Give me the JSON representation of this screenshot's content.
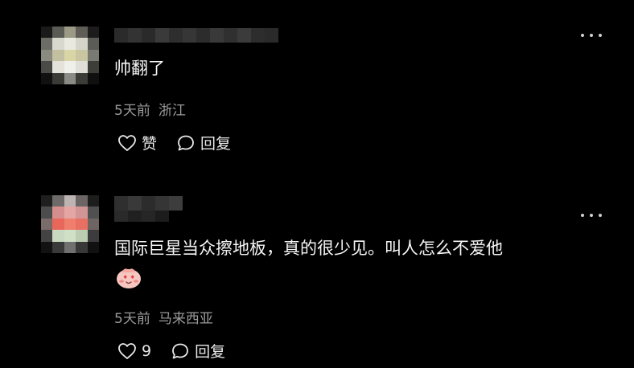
{
  "comments": [
    {
      "text": "帅翻了",
      "time": "5天前",
      "location": "浙江",
      "like_label": "赞",
      "reply_label": "回复"
    },
    {
      "text": "国际巨星当众擦地板，真的很少见。叫人怎么不爱他",
      "time": "5天前",
      "location": "马来西亚",
      "like_label": "9",
      "reply_label": "回复"
    }
  ],
  "colors": {
    "background": "#000000",
    "text": "#f5f5f5",
    "meta": "#9a9a9a"
  },
  "icons": [
    "more-icon",
    "heart-icon",
    "comment-bubble-icon",
    "blushing-face-emoji"
  ]
}
